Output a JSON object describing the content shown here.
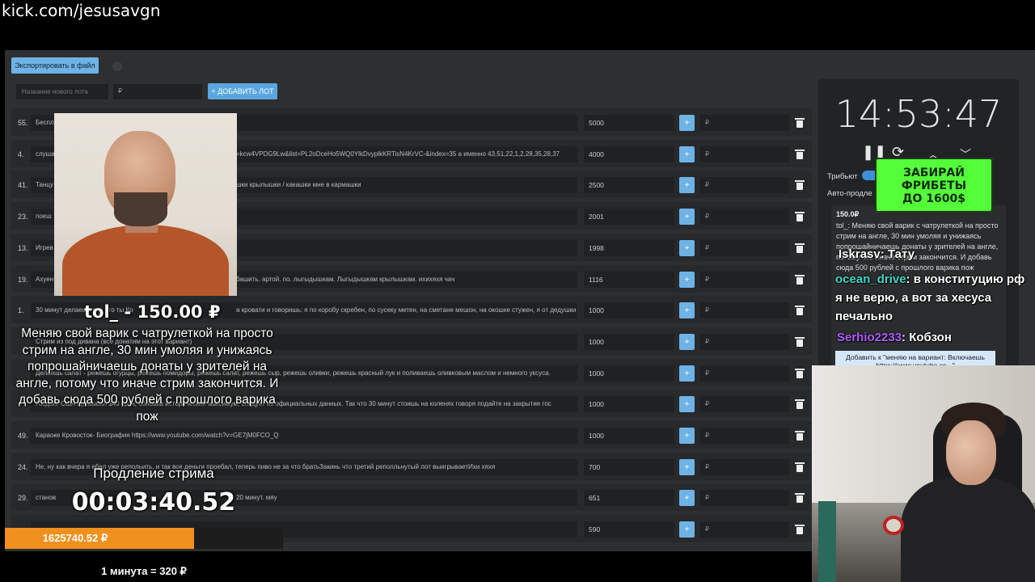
{
  "url": "kick.com/jesusavgn",
  "toolbar": {
    "export_label": "Экспортировать в файл"
  },
  "new_lot": {
    "name_placeholder": "Название нового лота",
    "price_placeholder": "₽",
    "add_label": "+ ДОБАВИТЬ ЛОТ"
  },
  "lots": [
    {
      "num": "55.",
      "name": "Беспл",
      "amount": "5000",
      "rub": "₽"
    },
    {
      "num": "4.",
      "name": "слушае",
      "tail": "=kcw4VPDG9Lw&list=PL2oDceHo5WQ0YlkDvyplkKRTisN4KrVC-&index=35 а именно 43,51,22,1,2,28,35,28,37",
      "amount": "4000",
      "rub": "₽"
    },
    {
      "num": "41.",
      "name": "Танцу",
      "tail": "шки крылышки / какашки мне в кармашки",
      "amount": "2500",
      "rub": "₽"
    },
    {
      "num": "23.",
      "name": "поеш",
      "amount": "2001",
      "rub": "₽"
    },
    {
      "num": "13.",
      "name": "Игрев",
      "amount": "1998",
      "rub": "₽"
    },
    {
      "num": "19.",
      "name": "Ахуен",
      "tail": "башить. артой. по. лыгыдышкам. Лыгыдышкам крылышкам. ихихяхя чач",
      "amount": "1116",
      "rub": "₽"
    },
    {
      "num": "1.",
      "name": "30 минут делаешь все что ты Ко",
      "tail": "а кровати и говоришь: я по коробу скребен, по сусеку метен, на сметане мешон, на окошке стужен, я от дедушки ушё",
      "amount": "1000",
      "rub": "₽"
    },
    {
      "num": "",
      "name": "Стрим из под дивана (все донатим на этот вариант)",
      "amount": "1000",
      "rub": "₽"
    },
    {
      "num": "",
      "name": "Делаешь салат - режешь огурцы, режешь помидоры, режешь салат, режешь сыр, режешь оливки, режешь красный лук и поливаешь оливковым маслом и немного уксуса.",
      "amount": "1000",
      "rub": "₽"
    },
    {
      "num": "",
      "name": "Госдолг США превысил $40 трлн, обновив исторический максимум, следует из официальных данных. Так что 30 минут стоишь на коленях говоря подайте на закрытие гос",
      "amount": "1000",
      "rub": "₽"
    },
    {
      "num": "49.",
      "name": "Караоке Кровосток- Биография https://www.youtube.com/watch?v=GE7jM0FCO_Q",
      "amount": "1000",
      "rub": "₽"
    },
    {
      "num": "24.",
      "name": "Не, ну как вчера я ебал уже репольить, и так все деньги проебал, теперь пиво не за что братьЗакинь что третий реполльнутый лот выигрываетИхи хяхя",
      "amount": "700",
      "rub": "₽"
    },
    {
      "num": "29.",
      "name": "станов",
      "tail": "20 минут. мяу",
      "amount": "651",
      "rub": "₽"
    },
    {
      "num": "",
      "name": "",
      "amount": "590",
      "rub": "₽"
    }
  ],
  "timer": {
    "clock": "14:53:47"
  },
  "settings": {
    "tribute_label": "Трибьют",
    "auto_extend_label": "Авто-продле"
  },
  "promo": {
    "line1": "ЗАБИРАЙ",
    "line2": "ФРИБЕТЫ",
    "line3": "ДО 1600$"
  },
  "donation_panel": {
    "price": "150.0₽",
    "text": "tol_: Меняю свой варик с чатрулеткой на просто стрим на англе, 30 мин умоляя и унижаясь попрошайничаешь донаты у зрителей на англе, потому что иначе стрим закончится. И добавь сюда 500 рублей с прошлого варика пож",
    "add_label": "Добавить к \"меняю на вариант: Включаешь https://www.youtube.co...\""
  },
  "chat": [
    {
      "nick": "Iskrasv",
      "text": ": Тату",
      "color": "#ffffff"
    },
    {
      "nick": "ocean_drive",
      "text": ": в конституцию рф я не верю, а вот за хесуса печально",
      "color": "#3fd6c9"
    },
    {
      "nick": "Serhio2233",
      "text": ": Кобзон",
      "color": "#b15cff"
    }
  ],
  "donation_alert": {
    "title": "tol_ - 150.00 ₽",
    "message": "Меняю свой варик с чатрулеткой на просто стрим на англе, 30 мин умоляя и унижаясь попрошайничаешь донаты у зрителей на англе, потому что иначе стрим закончится. И добавь сюда 500 рублей с прошлого варика пож"
  },
  "extension": {
    "label": "Продление стрима",
    "time": "00:03:40.52"
  },
  "total": {
    "amount": "1625740.52 ₽",
    "fill_fraction": 0.68
  },
  "rate": "1 минута = 320 ₽",
  "colors": {
    "accent": "#6fb3e6",
    "bar": "#f0911d",
    "promo": "#54ff3a"
  }
}
